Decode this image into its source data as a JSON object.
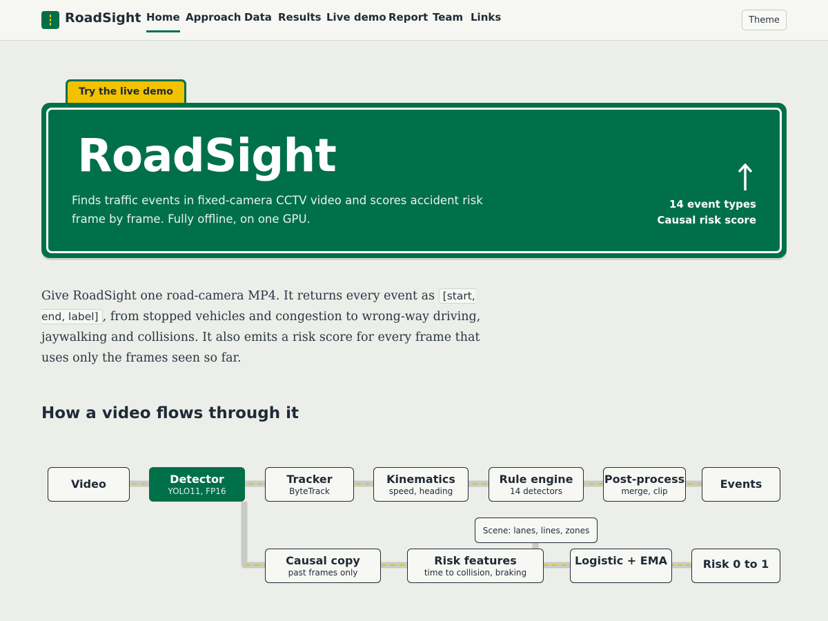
{
  "header": {
    "brand": "RoadSight",
    "nav": [
      "Home",
      "Approach",
      "Data",
      "Results",
      "Live demo",
      "Report",
      "Team",
      "Links"
    ],
    "active_nav": "Home",
    "theme_label": "Theme"
  },
  "hero": {
    "tab_label": "Try the live demo",
    "title": "RoadSight",
    "subtitle": "Finds traffic events in fixed-camera CCTV video and scores accident risk frame by frame. Fully offline, on one GPU.",
    "meta_line1": "14 event types",
    "meta_line2": "Causal risk score",
    "arrow_icon": "up-arrow-icon"
  },
  "intro": {
    "part1": "Give RoadSight one road-camera MP4. It returns every event as ",
    "code": "[start, end, label]",
    "part2": ", from stopped vehicles and congestion to wrong-way driving, jaywalking and collisions. It also emits a risk score for every frame that uses only the frames seen so far."
  },
  "flow": {
    "title": "How a video flows through it",
    "nodes": {
      "video": {
        "title": "Video",
        "sub": ""
      },
      "detector": {
        "title": "Detector",
        "sub": "YOLO11, FP16"
      },
      "tracker": {
        "title": "Tracker",
        "sub": "ByteTrack"
      },
      "kinematics": {
        "title": "Kinematics",
        "sub": "speed, heading"
      },
      "rule_engine": {
        "title": "Rule engine",
        "sub": "14 detectors"
      },
      "post_process": {
        "title": "Post-process",
        "sub": "merge, clip"
      },
      "events": {
        "title": "Events",
        "sub": ""
      },
      "scene": {
        "title": "Scene: lanes, lines, zones"
      },
      "causal_copy": {
        "title": "Causal copy",
        "sub": "past frames only"
      },
      "risk_features": {
        "title": "Risk features",
        "sub": "time to collision, braking"
      },
      "logistic": {
        "title": "Logistic + EMA",
        "sub": ""
      },
      "risk": {
        "title": "Risk 0 to 1",
        "sub": ""
      }
    }
  },
  "colors": {
    "brand_green": "#00704a",
    "sign_yellow": "#f2c200",
    "road_grey": "#c8ccc5",
    "lane_dash": "#f2c200"
  }
}
